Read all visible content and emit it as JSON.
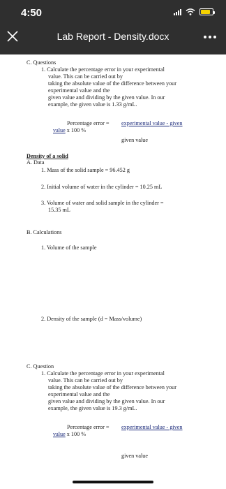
{
  "status_bar": {
    "time": "4:50"
  },
  "header": {
    "title": "Lab Report - Density.docx"
  },
  "document": {
    "section_c1": {
      "heading": "C. Questions",
      "item1_lines": [
        "1. Calculate the percentage error in your experimental",
        "value. This can be carried out by",
        "taking the absolute value of the difference between your",
        "experimental value and the",
        "given value and dividing by the given value. In our",
        "example, the given value is 1.33 g/mL."
      ],
      "formula_prefix": "Percentage error =",
      "formula_numerator": "experimental value - given",
      "formula_value": "value",
      "formula_suffix": "x 100 %",
      "formula_denominator": "given value"
    },
    "density_section": {
      "heading": "Density of a solid",
      "data_heading": "A. Data",
      "data_items": [
        "1. Mass of the solid sample = 96.452 g",
        "2. Initial volume of water in the cylinder = 10.25 mL",
        "3. Volume of water and solid sample in the cylinder =",
        "15.35 mL"
      ],
      "calc_heading": "B. Calculations",
      "calc_items": [
        "1. Volume of the sample",
        "2. Density of the sample (d = Mass/volume)"
      ]
    },
    "section_c2": {
      "heading": "C. Question",
      "item1_lines": [
        "1. Calculate the percentage error in your experimental",
        "value. This can be carried out by",
        "taking the absolute value of the difference between your",
        "experimental value and the",
        "given value and dividing by the given value. In our",
        "example, the given value is 19.3 g/mL."
      ],
      "formula_prefix": "Percentage error =",
      "formula_numerator": "experimental value - given",
      "formula_value": "value",
      "formula_suffix": "x 100 %",
      "formula_denominator": "given value"
    }
  },
  "colors": {
    "header_bg": "#2f2f2f",
    "battery": "#f5d100"
  }
}
